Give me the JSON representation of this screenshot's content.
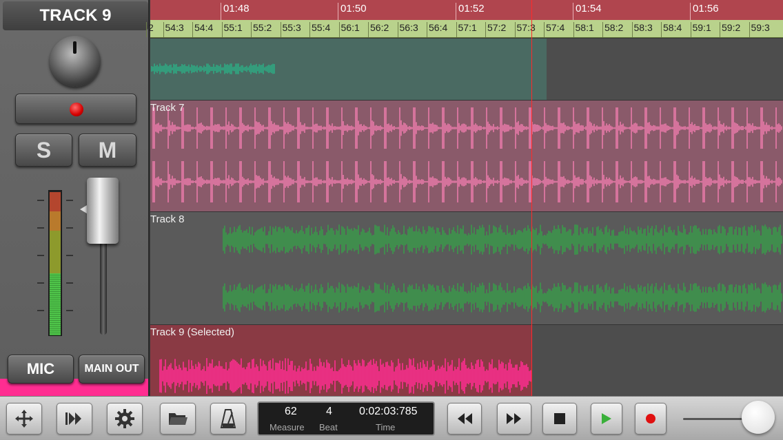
{
  "strip": {
    "title": "TRACK 9",
    "solo_label": "S",
    "mute_label": "M",
    "input_label": "MIC",
    "output_label": "MAIN OUT"
  },
  "ruler": {
    "times": [
      "01:48",
      "01:50",
      "01:52",
      "01:54",
      "01:56"
    ],
    "beats": [
      "2",
      "54:3",
      "54:4",
      "55:1",
      "55:2",
      "55:3",
      "55:4",
      "56:1",
      "56:2",
      "56:3",
      "56:4",
      "57:1",
      "57:2",
      "57:3",
      "57:4",
      "58:1",
      "58:2",
      "58:3",
      "58:4",
      "59:1",
      "59:2",
      "59:3"
    ]
  },
  "tracks": [
    {
      "label": "",
      "color": "#2fa882"
    },
    {
      "label": "Track 7",
      "color": "#e87aa8"
    },
    {
      "label": "Track 8",
      "color": "#3a9a4a"
    },
    {
      "label": "Track 9 (Selected)",
      "color": "#ff2d91"
    }
  ],
  "transport": {
    "measure": "62",
    "beat": "4",
    "time": "0:02:03:785",
    "measure_caption": "Measure",
    "beat_caption": "Beat",
    "time_caption": "Time"
  },
  "icons": [
    "move-icon",
    "fast-forward-snap-icon",
    "gear-icon",
    "folder-icon",
    "metronome-icon",
    "rewind-icon",
    "fast-forward-icon",
    "stop-icon",
    "play-icon",
    "record-icon"
  ],
  "colors": {
    "playhead": "#ff2a2a",
    "accent": "#ff2d91"
  }
}
